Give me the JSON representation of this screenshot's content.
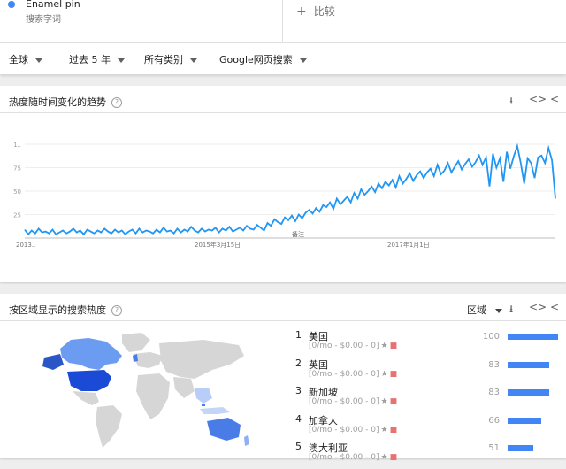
{
  "term": {
    "name": "Enamel pin",
    "sub": "搜索字词",
    "color": "#4285f4"
  },
  "compare_label": "比较",
  "filters": [
    "全球",
    "过去 5 年",
    "所有类别",
    "Google网页搜索"
  ],
  "trend_card": {
    "title": "热度随时间变化的趋势"
  },
  "region_card": {
    "title": "按区域显示的搜索热度",
    "selector": "区域"
  },
  "chart_data": {
    "type": "line",
    "series_color": "#2196f3",
    "yticks": [
      "1..",
      "75",
      "50",
      "25"
    ],
    "xticks": [
      "2013..",
      "2015年3月15日",
      "2017年1月1日"
    ],
    "annotation": "备注",
    "ylim": [
      0,
      100
    ],
    "values": [
      9,
      4,
      8,
      5,
      10,
      6,
      7,
      5,
      9,
      4,
      6,
      8,
      5,
      7,
      10,
      6,
      8,
      4,
      9,
      7,
      5,
      8,
      6,
      10,
      7,
      5,
      9,
      6,
      8,
      4,
      7,
      9,
      5,
      10,
      6,
      8,
      7,
      5,
      9,
      6,
      11,
      7,
      8,
      5,
      10,
      6,
      9,
      7,
      12,
      8,
      6,
      10,
      7,
      9,
      8,
      11,
      6,
      10,
      8,
      12,
      7,
      9,
      11,
      8,
      13,
      10,
      9,
      14,
      11,
      8,
      16,
      13,
      20,
      17,
      15,
      22,
      19,
      24,
      18,
      25,
      21,
      27,
      30,
      26,
      32,
      28,
      35,
      33,
      38,
      31,
      42,
      36,
      40,
      44,
      38,
      48,
      42,
      52,
      46,
      50,
      55,
      49,
      58,
      53,
      60,
      56,
      62,
      54,
      66,
      58,
      63,
      69,
      61,
      67,
      71,
      64,
      70,
      74,
      66,
      78,
      68,
      72,
      80,
      70,
      76,
      82,
      73,
      79,
      84,
      76,
      81,
      88,
      78,
      86,
      55,
      90,
      75,
      85,
      60,
      92,
      74,
      87,
      98,
      80,
      58,
      85,
      80,
      64,
      86,
      88,
      80,
      96,
      83,
      42
    ]
  },
  "regions": [
    {
      "rank": "1",
      "name": "美国",
      "meta": "[0/mo - $0.00 - 0]",
      "value": 100
    },
    {
      "rank": "2",
      "name": "英国",
      "meta": "[0/mo - $0.00 - 0]",
      "value": 83
    },
    {
      "rank": "3",
      "name": "新加坡",
      "meta": "[0/mo - $0.00 - 0]",
      "value": 83
    },
    {
      "rank": "4",
      "name": "加拿大",
      "meta": "[0/mo - $0.00 - 0]",
      "value": 66
    },
    {
      "rank": "5",
      "name": "澳大利亚",
      "meta": "[0/mo - $0.00 - 0]",
      "value": 51
    }
  ]
}
